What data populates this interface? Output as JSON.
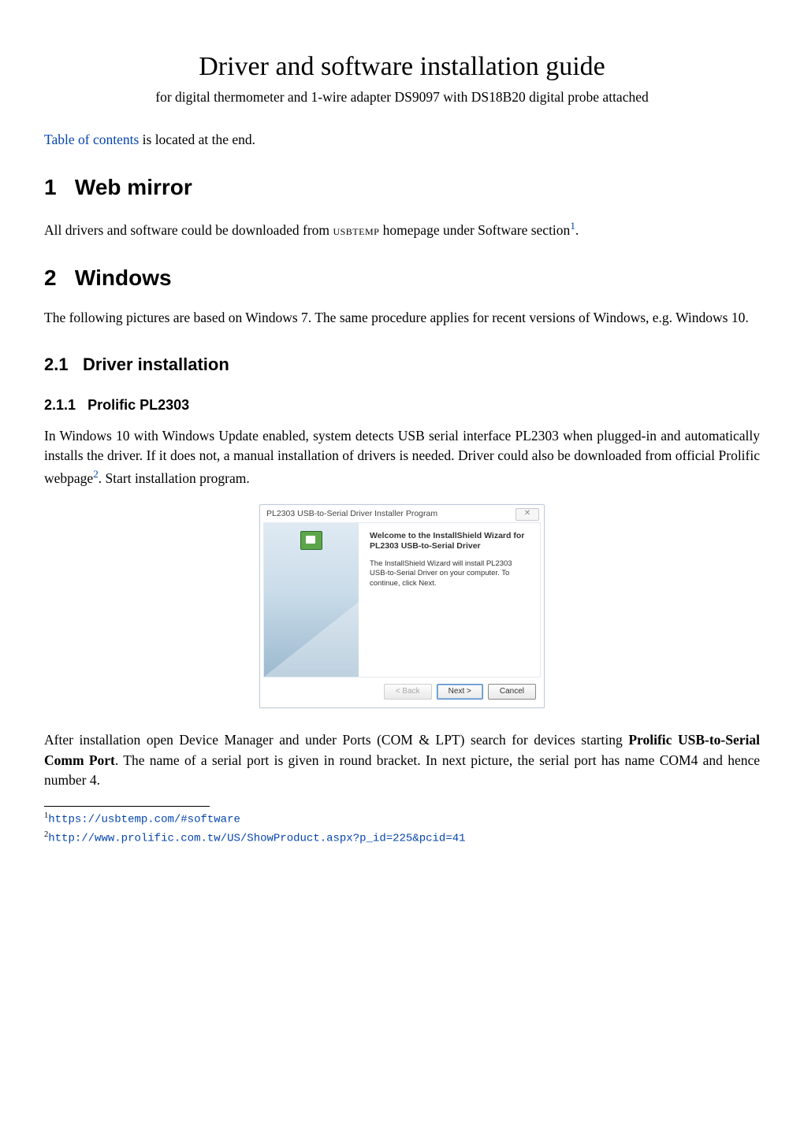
{
  "title": "Driver and software installation guide",
  "subtitle": "for digital thermometer and 1-wire adapter DS9097 with DS18B20 digital probe attached",
  "toc": {
    "link_text": "Table of contents",
    "suffix": " is located at the end."
  },
  "sections": {
    "web_mirror": {
      "num": "1",
      "title": "Web mirror",
      "para_pre": "All drivers and software could be downloaded from ",
      "sc_word": "usbtemp",
      "para_post": " homepage under Software section",
      "fn_ref": "1",
      "period": "."
    },
    "windows": {
      "num": "2",
      "title": "Windows",
      "intro": "The following pictures are based on Windows 7. The same procedure applies for recent versions of Windows, e.g. Windows 10."
    },
    "driver_install": {
      "num": "2.1",
      "title": "Driver installation"
    },
    "pl2303": {
      "num": "2.1.1",
      "title": "Prolific PL2303",
      "para1_pre": "In Windows 10 with Windows Update enabled, system detects USB serial interface PL2303 when plugged-in and automatically installs the driver. If it does not, a manual installation of drivers is needed. Driver could also be downloaded from official Prolific webpage",
      "fn_ref": "2",
      "para1_post": ". Start installation program.",
      "para2_pre": "After installation open Device Manager and under Ports (COM & LPT) search for devices starting ",
      "bold1": "Prolific USB-to-Serial Comm Port",
      "para2_post": ". The name of a serial port is given in round bracket. In next picture, the serial port has name COM4 and hence number 4."
    }
  },
  "installer": {
    "window_title": "PL2303 USB-to-Serial Driver Installer Program",
    "close_glyph": "✕",
    "heading": "Welcome to the InstallShield Wizard for PL2303 USB-to-Serial Driver",
    "desc": "The InstallShield Wizard will install PL2303 USB-to-Serial Driver on your computer.  To continue, click Next.",
    "buttons": {
      "back": "< Back",
      "next": "Next >",
      "cancel": "Cancel"
    }
  },
  "footnotes": {
    "f1": {
      "num": "1",
      "url": "https://usbtemp.com/#software"
    },
    "f2": {
      "num": "2",
      "url": "http://www.prolific.com.tw/US/ShowProduct.aspx?p_id=225&pcid=41"
    }
  }
}
